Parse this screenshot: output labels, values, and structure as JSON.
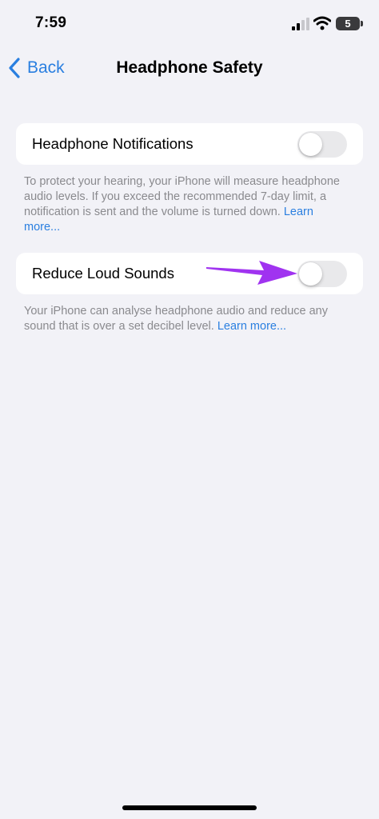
{
  "status_bar": {
    "time": "7:59",
    "battery_level": "5",
    "signal_icon": "cellular-signal-icon",
    "wifi_icon": "wifi-icon"
  },
  "nav": {
    "back_label": "Back",
    "title": "Headphone Safety",
    "accent_color": "#2a7fe0"
  },
  "sections": [
    {
      "label": "Headphone Notifications",
      "toggle_on": false,
      "footer_text": "To protect your hearing, your iPhone will measure headphone audio levels. If you exceed the recommended 7-day limit, a notification is sent and the volume is turned down.",
      "footer_link": "Learn more..."
    },
    {
      "label": "Reduce Loud Sounds",
      "toggle_on": false,
      "footer_text": "Your iPhone can analyse headphone audio and reduce any sound that is over a set decibel level.",
      "footer_link": "Learn more..."
    }
  ],
  "annotation": {
    "arrow_color": "#a033f0"
  }
}
